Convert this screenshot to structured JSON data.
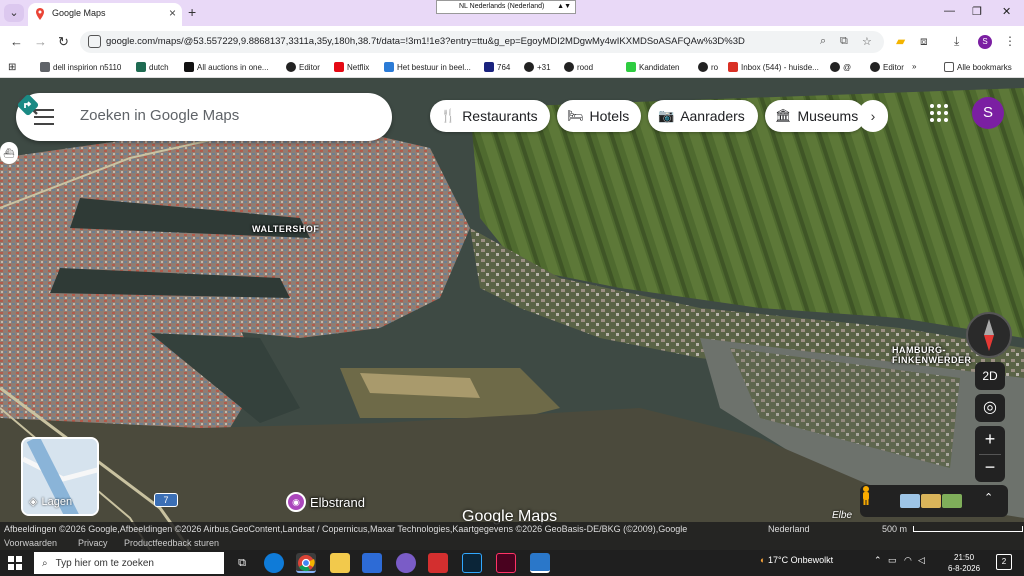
{
  "browser": {
    "tab_title": "Google Maps",
    "locale_selector": "NL Nederlands (Nederland)",
    "url": "google.com/maps/@53.557229,9.8868137,3311a,35y,180h,38.7t/data=!3m1!1e3?entry=ttu&g_ep=EgoyMDI2MDgwMy4wIKXMDSoASAFQAw%3D%3D",
    "profile_initial": "S"
  },
  "bookmarks": [
    {
      "label": "dell inspirion n5110",
      "icon": "folder-icon",
      "color": "#5f6368"
    },
    {
      "label": "dutch",
      "icon": "dutch-icon",
      "color": "#1e6b52"
    },
    {
      "label": "All auctions in one...",
      "icon": "auction-icon",
      "color": "#111111"
    },
    {
      "label": "Editor",
      "icon": "editor-icon",
      "color": "#222222"
    },
    {
      "label": "Netflix",
      "icon": "netflix-icon",
      "color": "#e50914"
    },
    {
      "label": "Het bestuur in beel...",
      "icon": "arrow-icon",
      "color": "#2b7bd6"
    },
    {
      "label": "764",
      "icon": "p-icon",
      "color": "#1a237e"
    },
    {
      "label": "+31",
      "icon": "globe-icon",
      "color": "#222222"
    },
    {
      "label": "rood",
      "icon": "globe-icon",
      "color": "#222222"
    },
    {
      "label": "Kandidaten",
      "icon": "kandidaten-icon",
      "color": "#2ecc40"
    },
    {
      "label": "ro",
      "icon": "globe-icon",
      "color": "#222222"
    },
    {
      "label": "Inbox (544) - huisde...",
      "icon": "gmail-icon",
      "color": "#d93025"
    },
    {
      "label": "@",
      "icon": "globe-icon",
      "color": "#222222"
    },
    {
      "label": "Editor",
      "icon": "editor-icon",
      "color": "#222222"
    }
  ],
  "bookmarks_overflow": "»",
  "bookmarks_all": "Alle bookmarks",
  "maps": {
    "search_placeholder": "Zoeken in Google Maps",
    "chips": [
      {
        "label": "Restaurants",
        "icon": "fork-knife-icon",
        "glyph": "🍴"
      },
      {
        "label": "Hotels",
        "icon": "bed-icon",
        "glyph": "🛏"
      },
      {
        "label": "Aanraders",
        "icon": "camera-icon",
        "glyph": "📷"
      },
      {
        "label": "Museums",
        "icon": "museum-icon",
        "glyph": "🏛"
      }
    ],
    "account_initial": "S",
    "labels": {
      "waltershof": "WALTERSHOF",
      "finkenwerder": "HAMBURG-FINKENWERDER",
      "elbe": "Elbe"
    },
    "view_toggle": "2D",
    "zoom_in": "+",
    "zoom_out": "−",
    "layers_label": "Lagen",
    "route_number": "7",
    "poi_name": "Elbstrand",
    "logo": "Google Maps",
    "attribution": "Afbeeldingen ©2026 Google,Afbeeldingen ©2026 Airbus,GeoContent,Landsat / Copernicus,Maxar Technologies,Kaartgegevens ©2026 GeoBasis-DE/BKG (©2009),Google",
    "region": "Nederland",
    "scale": "500 m",
    "footer_links": [
      "Voorwaarden",
      "Privacy",
      "Productfeedback sturen"
    ]
  },
  "taskbar": {
    "search_placeholder": "Typ hier om te zoeken",
    "weather": "17°C Onbewolkt",
    "time": "21:50",
    "date": "6-8-2026",
    "notifications": "2"
  },
  "colors": {
    "tab_strip": "#e9d9f7",
    "accent_purple": "#7b1fa2",
    "water": "#3b4a45",
    "land": "#4a5a2c"
  }
}
